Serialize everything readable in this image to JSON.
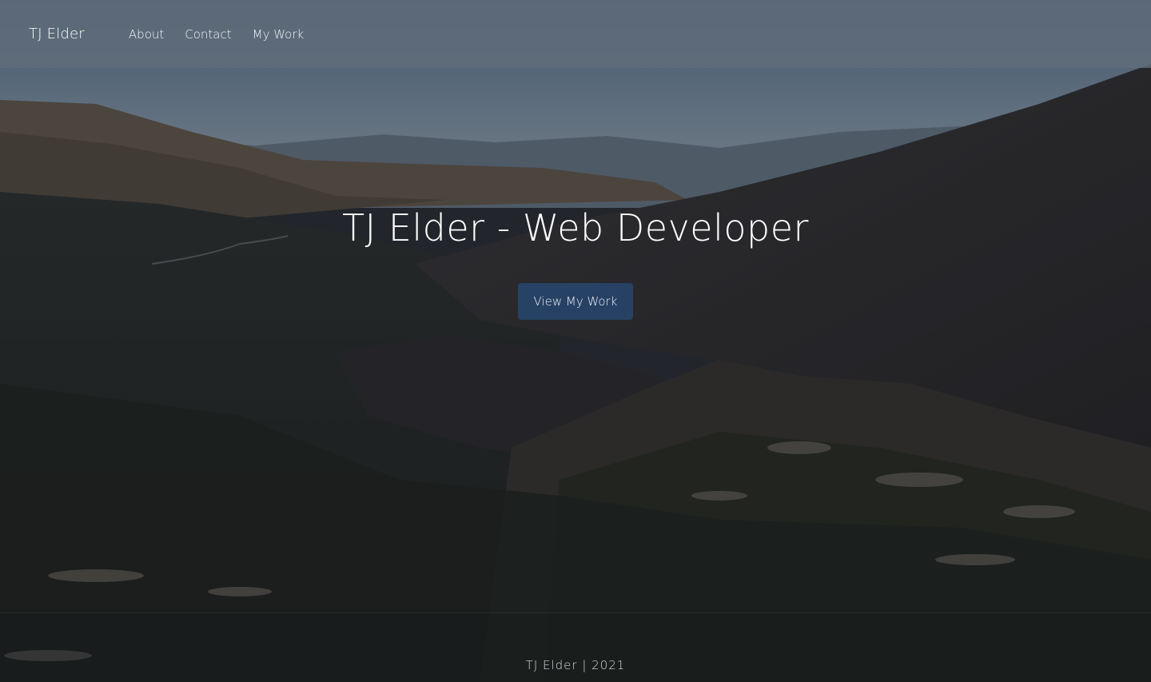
{
  "nav": {
    "brand": "TJ Elder",
    "links": [
      "About",
      "Contact",
      "My Work"
    ]
  },
  "hero": {
    "title": "TJ Elder - Web Developer",
    "cta_label": "View My Work"
  },
  "footer": {
    "text": "TJ Elder | 2021"
  },
  "colors": {
    "navbar": "#606c7a",
    "cta": "#26466e",
    "text": "#ffffff"
  }
}
